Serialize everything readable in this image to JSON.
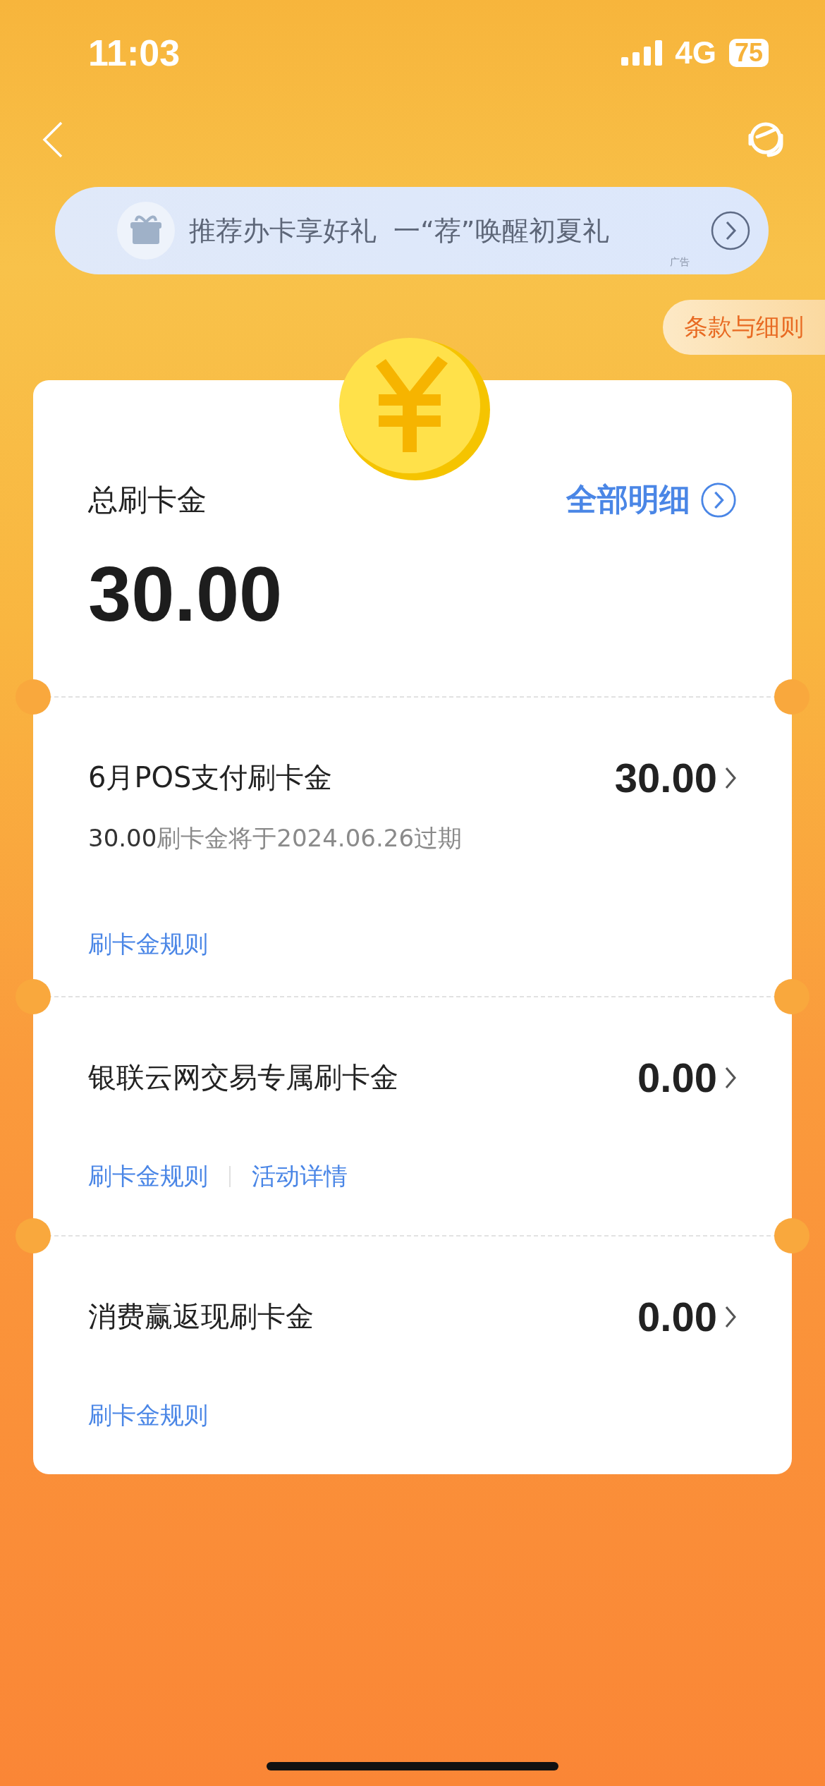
{
  "status_bar": {
    "time": "11:03",
    "network": "4G",
    "battery": "75"
  },
  "banner": {
    "text": "推荐办卡享好礼  一“荐”唤醒初夏礼",
    "ad_label": "广告"
  },
  "terms_button": "条款与细则",
  "summary": {
    "label": "总刷卡金",
    "details_link": "全部明细",
    "amount": "30.00"
  },
  "rows": [
    {
      "title": "6月POS支付刷卡金",
      "amount": "30.00",
      "expiry_amount": "30.00",
      "expiry_text": "刷卡金将于2024.06.26过期",
      "links": [
        "刷卡金规则"
      ]
    },
    {
      "title": "银联云网交易专属刷卡金",
      "amount": "0.00",
      "links": [
        "刷卡金规则",
        "活动详情"
      ]
    },
    {
      "title": "消费赢返现刷卡金",
      "amount": "0.00",
      "links": [
        "刷卡金规则"
      ]
    }
  ]
}
